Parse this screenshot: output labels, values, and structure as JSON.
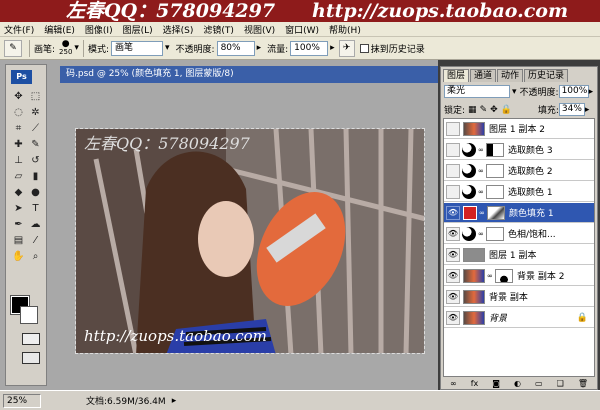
{
  "banner": {
    "left": "左春QQ：578094297",
    "right": "http://zuops.taobao.com"
  },
  "menu": {
    "items": [
      "文件(F)",
      "编辑(E)",
      "图像(I)",
      "图层(L)",
      "选择(S)",
      "滤镜(T)",
      "视图(V)",
      "窗口(W)",
      "帮助(H)"
    ]
  },
  "options": {
    "brush_label": "画笔:",
    "brush_size": "250",
    "mode_label": "模式:",
    "mode_value": "画笔",
    "opacity_label": "不透明度:",
    "opacity_value": "80%",
    "flow_label": "流量:",
    "flow_value": "100%",
    "history_label": "抹到历史记录"
  },
  "document": {
    "title": "码.psd @ 25% (颜色填充 1, 图层蒙版/8)",
    "watermark_top": "左春QQ：578094297",
    "watermark_bottom": "http://zuops.taobao.com"
  },
  "status": {
    "zoom": "25%",
    "doc_info": "文档:6.59M/36.4M"
  },
  "panel": {
    "tabs": [
      "图层",
      "通道",
      "动作",
      "历史记录"
    ],
    "blend_mode": "柔光",
    "opacity_label": "不透明度:",
    "opacity_value": "100%",
    "lock_label": "锁定:",
    "fill_label": "填充:",
    "fill_value": "34%",
    "layers": [
      {
        "name": "图层 1 副本 2",
        "visible": false,
        "kind": "photo"
      },
      {
        "name": "选取颜色 3",
        "visible": false,
        "kind": "adjust"
      },
      {
        "name": "选取颜色 2",
        "visible": false,
        "kind": "adjust"
      },
      {
        "name": "选取颜色 1",
        "visible": false,
        "kind": "adjust"
      },
      {
        "name": "颜色填充 1",
        "visible": true,
        "kind": "fill",
        "selected": true
      },
      {
        "name": "色相/饱和...",
        "visible": true,
        "kind": "adjust"
      },
      {
        "name": "图层 1 副本",
        "visible": true,
        "kind": "gray"
      },
      {
        "name": "背景 副本 2",
        "visible": true,
        "kind": "photo-mask"
      },
      {
        "name": "背景 副本",
        "visible": true,
        "kind": "photo"
      },
      {
        "name": "背景",
        "visible": true,
        "kind": "photo-locked"
      }
    ]
  },
  "colors": {
    "fill_swatch": "#d42121",
    "selection": "#2f57b1",
    "banner": "#8e1b1b"
  }
}
